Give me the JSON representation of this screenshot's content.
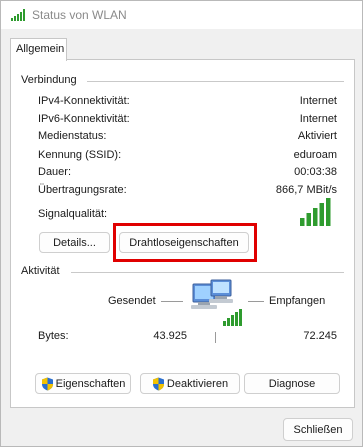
{
  "window": {
    "title": "Status von WLAN",
    "icon": "wifi-signal-icon"
  },
  "tabs": [
    {
      "label": "Allgemein",
      "selected": true
    }
  ],
  "connection": {
    "title": "Verbindung",
    "rows": [
      {
        "label": "IPv4-Konnektivität:",
        "value": "Internet"
      },
      {
        "label": "IPv6-Konnektivität:",
        "value": "Internet"
      },
      {
        "label": "Medienstatus:",
        "value": "Aktiviert"
      },
      {
        "label": "Kennung (SSID):",
        "value": "eduroam"
      },
      {
        "label": "Dauer:",
        "value": "00:03:38"
      },
      {
        "label": "Übertragungsrate:",
        "value": "866,7 MBit/s"
      }
    ],
    "signal_label": "Signalqualität:",
    "signal_bars_filled": 5,
    "signal_bars_total": 5,
    "signal_icon": "signal-strength-icon"
  },
  "buttons": {
    "details": "Details...",
    "wireless_properties": "Drahtloseigenschaften"
  },
  "activity": {
    "title": "Aktivität",
    "sent_label": "Gesendet",
    "received_label": "Empfangen",
    "bytes_label": "Bytes:",
    "bytes_sent": "43.925",
    "bytes_received": "72.245",
    "icon": "network-computers-icon"
  },
  "bottom_buttons": {
    "properties": "Eigenschaften",
    "disable": "Deaktivieren",
    "diagnose": "Diagnose"
  },
  "close_label": "Schließen",
  "colors": {
    "signal": "#2e9b2e",
    "highlight": "#e00000",
    "shield_blue": "#2a6fcf",
    "shield_yellow": "#f2c200"
  }
}
